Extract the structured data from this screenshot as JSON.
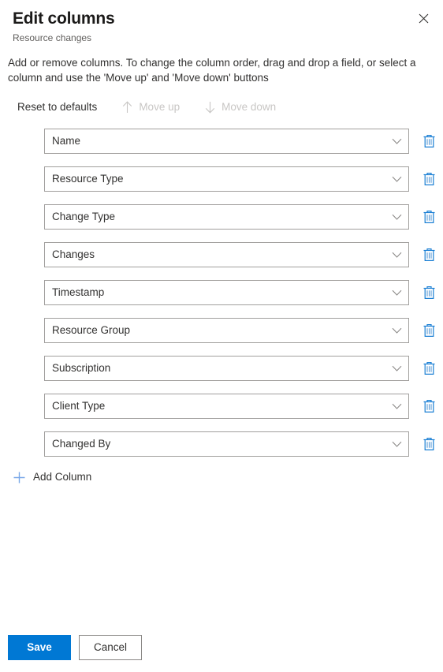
{
  "panel": {
    "title": "Edit columns",
    "subtitle": "Resource changes",
    "description": "Add or remove columns. To change the column order, drag and drop a field, or select a column and use the 'Move up' and 'Move down' buttons",
    "close_icon": "close-icon"
  },
  "command_bar": {
    "reset_label": "Reset to defaults",
    "move_up_label": "Move up",
    "move_down_label": "Move down",
    "move_up_icon": "arrow-up-icon",
    "move_down_icon": "arrow-down-icon",
    "move_up_disabled": true,
    "move_down_disabled": true
  },
  "columns": [
    {
      "label": "Name"
    },
    {
      "label": "Resource Type"
    },
    {
      "label": "Change Type"
    },
    {
      "label": "Changes"
    },
    {
      "label": "Timestamp"
    },
    {
      "label": "Resource Group"
    },
    {
      "label": "Subscription"
    },
    {
      "label": "Client Type"
    },
    {
      "label": "Changed By"
    }
  ],
  "row_icons": {
    "chevron": "chevron-down-icon",
    "delete": "trash-icon"
  },
  "add_column": {
    "label": "Add Column",
    "icon": "plus-icon"
  },
  "footer": {
    "save_label": "Save",
    "cancel_label": "Cancel"
  },
  "colors": {
    "accent": "#0078d4",
    "accent_light": "#7aa8e8",
    "text": "#323130",
    "text_secondary": "#605e5c",
    "disabled": "#c8c6c4",
    "border": "#a19f9d"
  }
}
